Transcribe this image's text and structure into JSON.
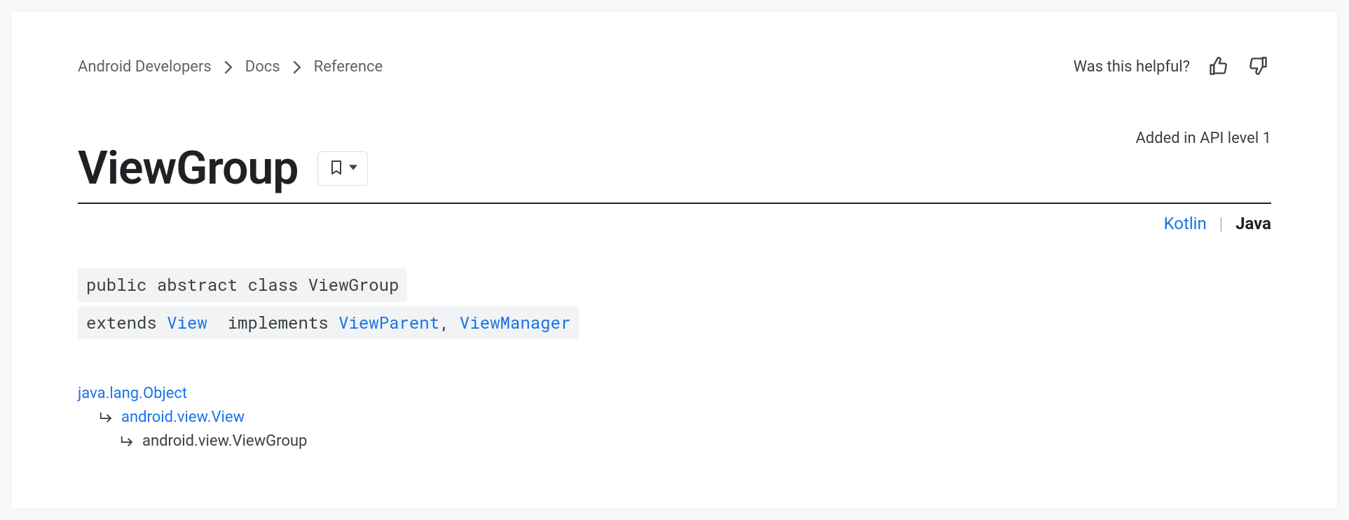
{
  "breadcrumb": {
    "items": [
      "Android Developers",
      "Docs",
      "Reference"
    ]
  },
  "feedback": {
    "prompt": "Was this helpful?"
  },
  "api_level_label": "Added in API level 1",
  "title": "ViewGroup",
  "language_switch": {
    "alt": "Kotlin",
    "active": "Java",
    "divider": "|"
  },
  "signature": {
    "line1_prefix": "public abstract class ",
    "line1_class": "ViewGroup",
    "line2_extends": "extends ",
    "line2_super": "View",
    "line2_implements": "implements ",
    "line2_iface1": "ViewParent",
    "line2_sep": ", ",
    "line2_iface2": "ViewManager"
  },
  "hierarchy": {
    "level0": "java.lang.Object",
    "level1": "android.view.View",
    "level2": "android.view.ViewGroup"
  }
}
